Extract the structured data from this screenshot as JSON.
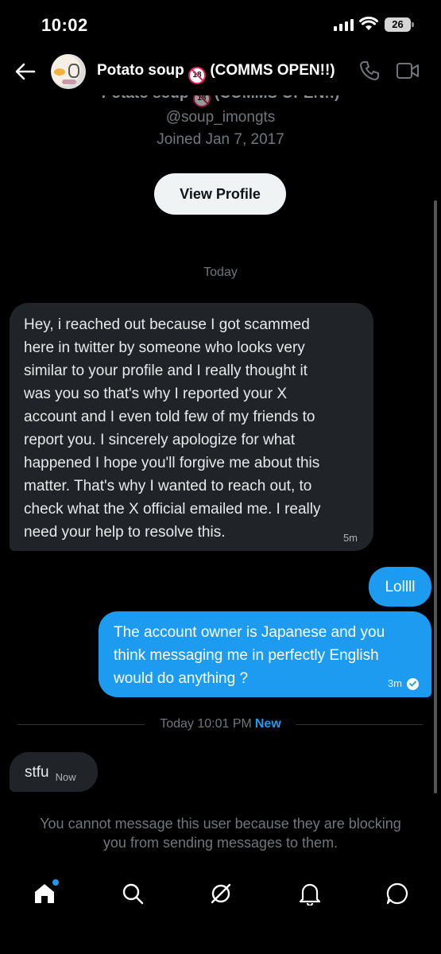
{
  "status_bar": {
    "time": "10:02",
    "battery": "26"
  },
  "header": {
    "title": "Potato soup",
    "title_suffix": "(COMMS OPEN!!)",
    "age_badge": "18"
  },
  "profile": {
    "handle": "@soup_imongts",
    "joined": "Joined Jan 7, 2017",
    "view_profile_label": "View Profile"
  },
  "conversation": {
    "day_label": "Today",
    "messages": [
      {
        "direction": "incoming",
        "lines": [
          "Hey, i reached out because I got scammed",
          "here in twitter by someone who looks very",
          "similar to your profile and I really thought it",
          "was you so that's why I reported your X",
          "account and I even told few of my friends to",
          "report you. I sincerely apologize for what",
          "happened I hope you'll forgive me about this",
          "matter. That's why I wanted to reach out, to",
          "check what the X official emailed me. I really",
          "need your help to resolve this."
        ],
        "time": "5m"
      },
      {
        "direction": "outgoing",
        "lines": [
          "Lollll"
        ],
        "time": ""
      },
      {
        "direction": "outgoing",
        "lines": [
          "The account owner is Japanese and you",
          "think messaging me in perfectly English",
          "would do anything ?"
        ],
        "time": "3m"
      },
      {
        "direction": "incoming",
        "lines": [
          "stfu"
        ],
        "time": "Now"
      }
    ],
    "divider": {
      "label": "Today 10:01 PM",
      "badge": "New"
    },
    "blocked_lines": [
      "You cannot message this user because they are blocking",
      "you from sending messages to them."
    ]
  },
  "colors": {
    "accent": "#1d9bf0",
    "incoming_bubble": "#202327",
    "background": "#000000"
  },
  "bottom_nav": {
    "items": [
      "home-icon",
      "search-icon",
      "grok-icon",
      "notifications-icon",
      "messages-icon"
    ]
  }
}
